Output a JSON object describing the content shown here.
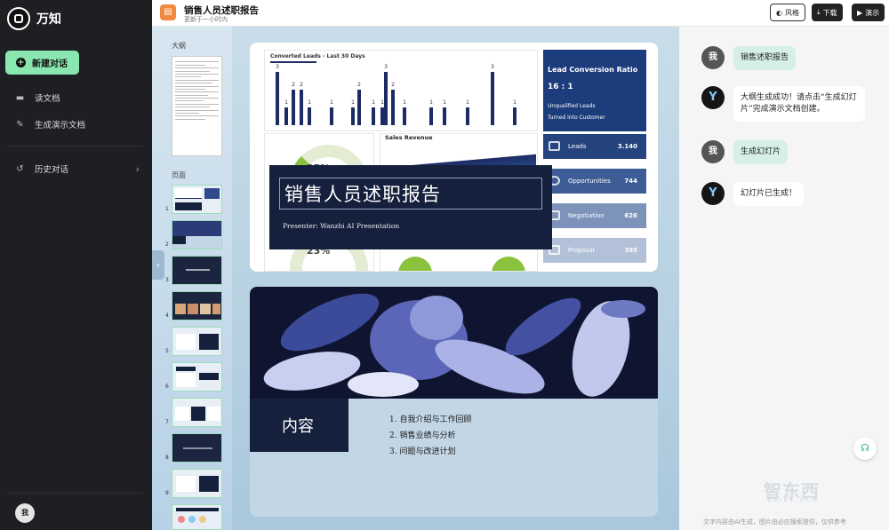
{
  "app": {
    "name": "万知"
  },
  "sidebar": {
    "new_chat": "新建对话",
    "items": [
      {
        "label": "读文档",
        "icon": "folder-icon"
      },
      {
        "label": "生成演示文档",
        "icon": "edit-doc-icon"
      },
      {
        "label": "历史对话",
        "icon": "history-icon"
      }
    ],
    "user_avatar": "我"
  },
  "topbar": {
    "title": "销售人员述职报告",
    "subtitle": "更新于一小时内",
    "style_label": "风格",
    "download_label": "下载",
    "present_label": "演示"
  },
  "outline": {
    "outline_label": "大纲",
    "pages_label": "页面",
    "page_numbers": [
      "1",
      "2",
      "3",
      "4",
      "5",
      "6",
      "7",
      "8",
      "9"
    ]
  },
  "slide1": {
    "title": "销售人员述职报告",
    "presenter": "Presenter: Wanzhi AI Presentation",
    "chart_title": "Converted  Leads - Last 30 Days",
    "bar_labels": [
      "3",
      "1",
      "2",
      "2",
      "1",
      "1",
      "1",
      "2",
      "1",
      "1",
      "3",
      "2",
      "1",
      "1",
      "1",
      "1",
      "3",
      "1"
    ],
    "bar_values": [
      3,
      1,
      2,
      2,
      1,
      1,
      1,
      2,
      1,
      1,
      3,
      2,
      1,
      1,
      1,
      1,
      3,
      1
    ],
    "sales_revenue": "Sales Revenue",
    "pct_top": "25%",
    "pct_bottom": "23%",
    "lead_conversion": {
      "title": "Lead Conversion Ratio",
      "ratio": "16 : 1",
      "line1": "Unqualified Leads",
      "line2": "Turned into Customer"
    },
    "metrics": [
      {
        "label": "Leads",
        "value": "3.140",
        "color": "#24437f"
      },
      {
        "label": "Opportunities",
        "value": "744",
        "color": "#3e5d96"
      },
      {
        "label": "Negotiation",
        "value": "626",
        "color": "#7d93ba"
      },
      {
        "label": "Proposal",
        "value": "395",
        "color": "#b2c1d8"
      }
    ]
  },
  "slide2": {
    "title": "内容",
    "items": [
      "1. 自我介绍与工作回顾",
      "2. 销售业绩与分析",
      "3. 问题与改进计划"
    ]
  },
  "chat": {
    "messages": [
      {
        "role": "user",
        "avatar": "我",
        "text": "销售述职报告"
      },
      {
        "role": "bot",
        "avatar": "Y",
        "text": "大纲生成成功！请点击“生成幻灯片”完成演示文档创建。"
      },
      {
        "role": "user",
        "avatar": "我",
        "text": "生成幻灯片"
      },
      {
        "role": "bot",
        "avatar": "Y",
        "text": "幻灯片已生成！"
      }
    ],
    "watermark": "智东西",
    "watermark_sub": "zhidx.com",
    "disclaimer": "文字内容由AI生成，图片由必应搜索提供，仅供参考"
  }
}
